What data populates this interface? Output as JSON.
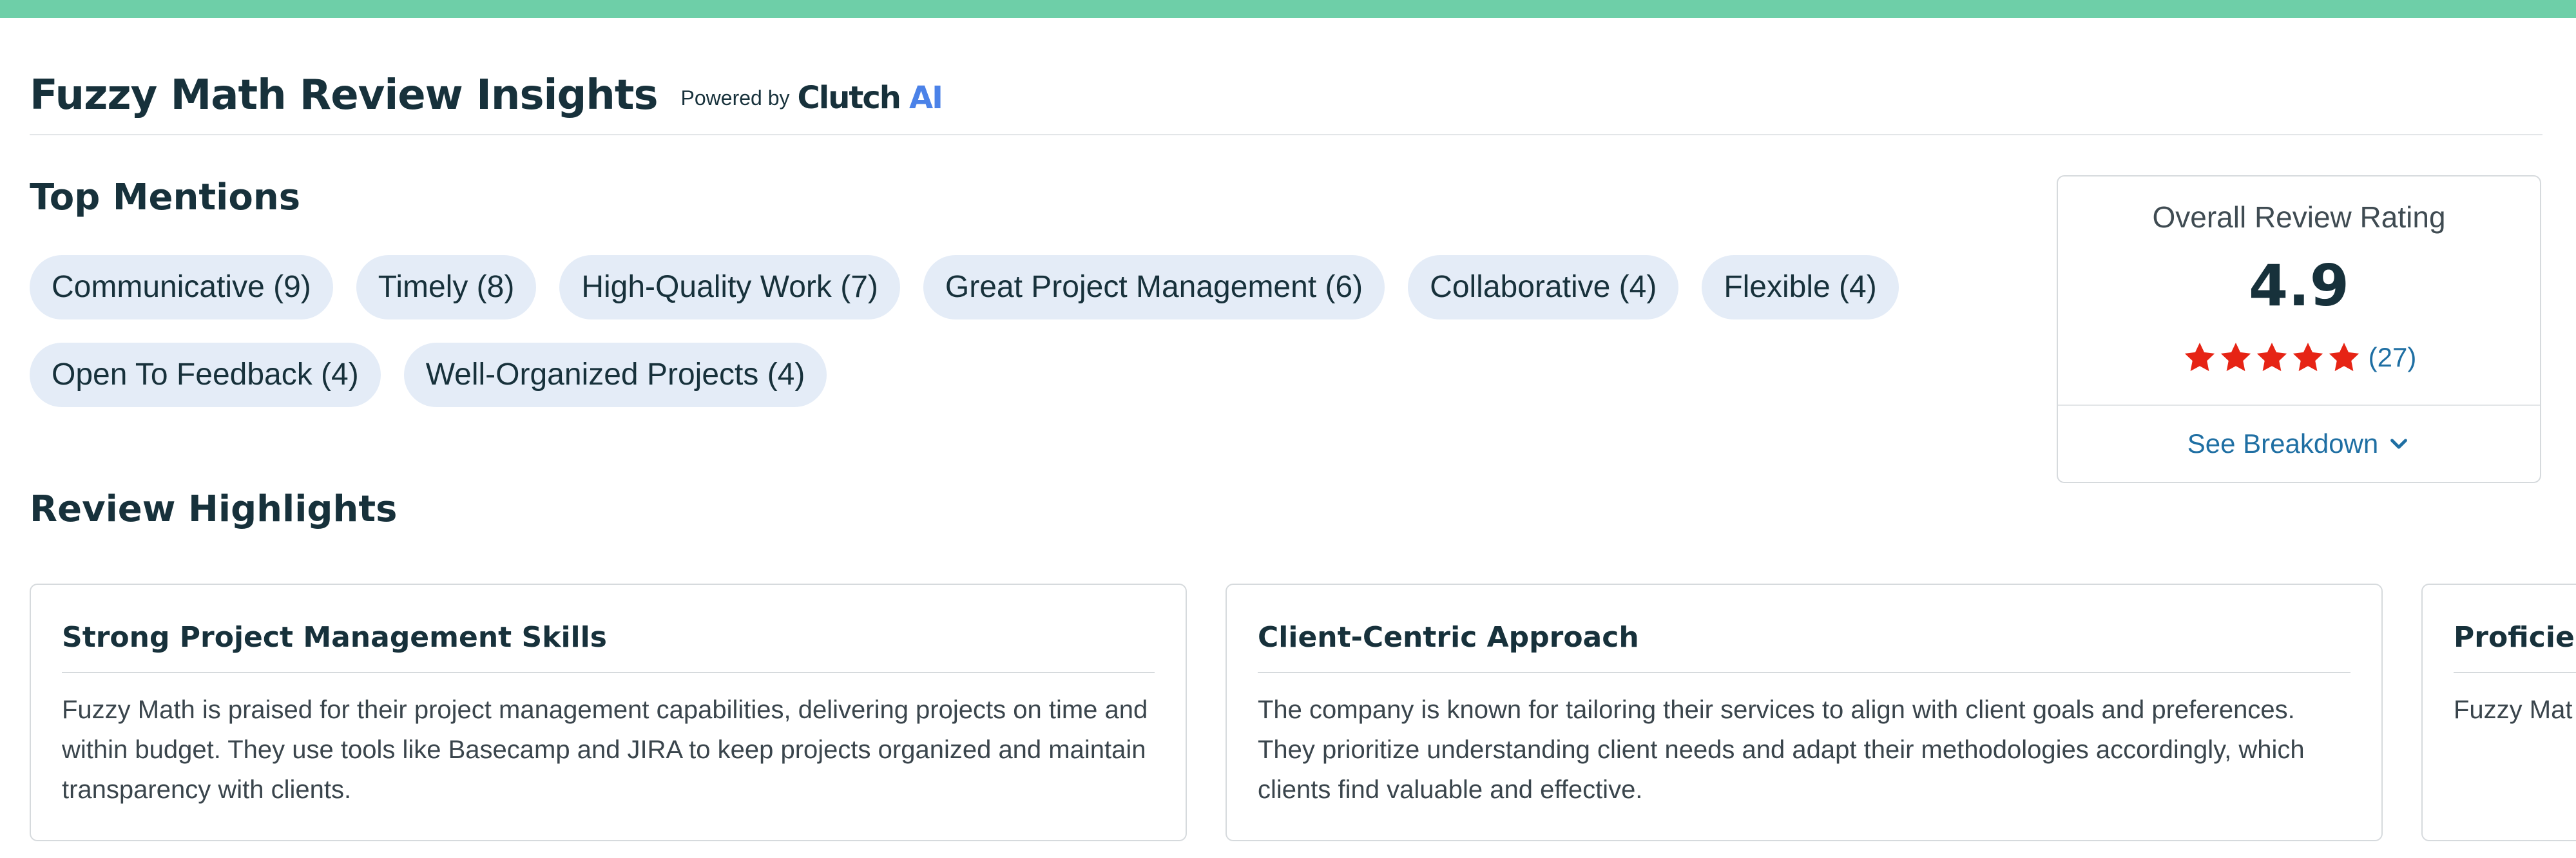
{
  "colors": {
    "top_bar": "#6ecfa8",
    "chip_bg": "#e4ecf7",
    "star": "#e62415",
    "link": "#1f6fa3",
    "logo_ai": "#4b82e8"
  },
  "header": {
    "title": "Fuzzy Math Review Insights",
    "powered_by": "Powered by",
    "logo_word": "Clutch",
    "logo_ai": "AI"
  },
  "top_mentions": {
    "title": "Top Mentions",
    "chips": [
      "Communicative (9)",
      "Timely (8)",
      "High-Quality Work (7)",
      "Great Project Management (6)",
      "Collaborative (4)",
      "Flexible (4)",
      "Open To Feedback (4)",
      "Well-Organized Projects (4)"
    ]
  },
  "rating": {
    "label": "Overall Review Rating",
    "value": "4.9",
    "stars_filled": 5,
    "count": "(27)",
    "breakdown_label": "See Breakdown"
  },
  "highlights": {
    "title": "Review Highlights",
    "cards": [
      {
        "title": "Strong Project Management Skills",
        "body": "Fuzzy Math is praised for their project management capabilities, delivering projects on time and within budget. They use tools like Basecamp and JIRA to keep projects organized and maintain transparency with clients."
      },
      {
        "title": "Client-Centric Approach",
        "body": "The company is known for tailoring their services to align with client goals and preferences. They prioritize understanding client needs and adapt their methodologies accordingly, which clients find valuable and effective."
      },
      {
        "title": "Proficien",
        "body": "Fuzzy Mat Their exper developme"
      }
    ]
  }
}
